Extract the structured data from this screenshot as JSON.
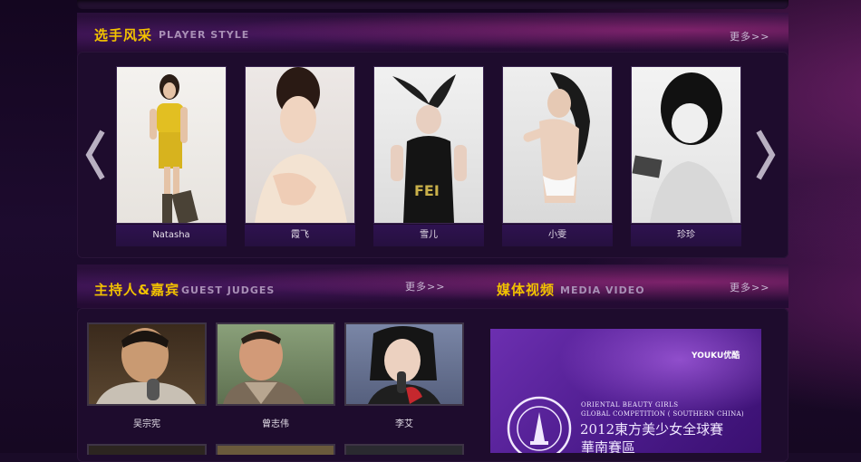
{
  "player_section": {
    "title_cn": "选手风采",
    "title_en": "PLAYER STYLE",
    "more": "更多>>",
    "players": [
      {
        "name": "Natasha"
      },
      {
        "name": "霞飞"
      },
      {
        "name": "雪儿"
      },
      {
        "name": "小雯"
      },
      {
        "name": "珍珍"
      }
    ]
  },
  "judges_section": {
    "title_cn": "主持人&嘉宾",
    "title_en": "GUEST JUDGES",
    "more": "更多>>",
    "judges": [
      {
        "name": "吴宗宪"
      },
      {
        "name": "曾志伟"
      },
      {
        "name": "李艾"
      }
    ]
  },
  "media_section": {
    "title_cn": "媒体视频",
    "title_en": "MEDIA  VIDEO",
    "more": "更多>>",
    "video": {
      "logo": "YOUKU优酷",
      "line1": "ORIENTAL BEAUTY GIRLS",
      "line2": "GLOBAL COMPETITION ( SOUTHERN CHINA)",
      "title_cn": "2012東方美少女全球賽",
      "subtitle_cn": "華南賽區",
      "seal_text": "ORIENTAL BEAUTY GIRLS GLOBAL COMPETITION"
    }
  },
  "colors": {
    "accent_title": "#f2c200",
    "background": "#1a0b28"
  }
}
